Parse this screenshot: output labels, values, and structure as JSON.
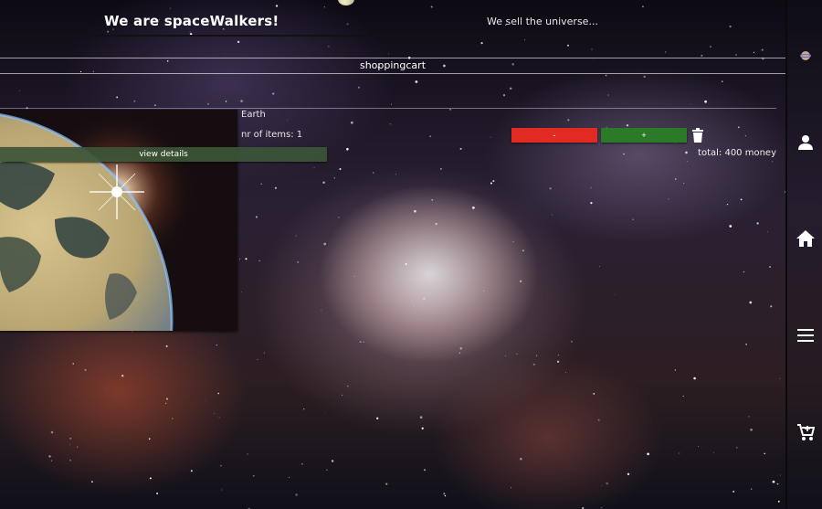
{
  "header": {
    "site_title": "We are spaceWalkers!",
    "tagline": "We sell the universe..."
  },
  "cart": {
    "title": "shoppingcart",
    "item": {
      "name": "Earth",
      "count_label": "nr of items: 1",
      "view_details_label": "view details",
      "decrease_label": "-",
      "increase_label": "+"
    },
    "total_label": "total: 400 money"
  },
  "sidebar": {
    "icons": [
      "account-icon",
      "home-icon",
      "menu-icon",
      "cart-icon"
    ]
  },
  "colors": {
    "decrease": "#e12b22",
    "increase": "#2a7a28",
    "view_details": "#3c5537"
  }
}
